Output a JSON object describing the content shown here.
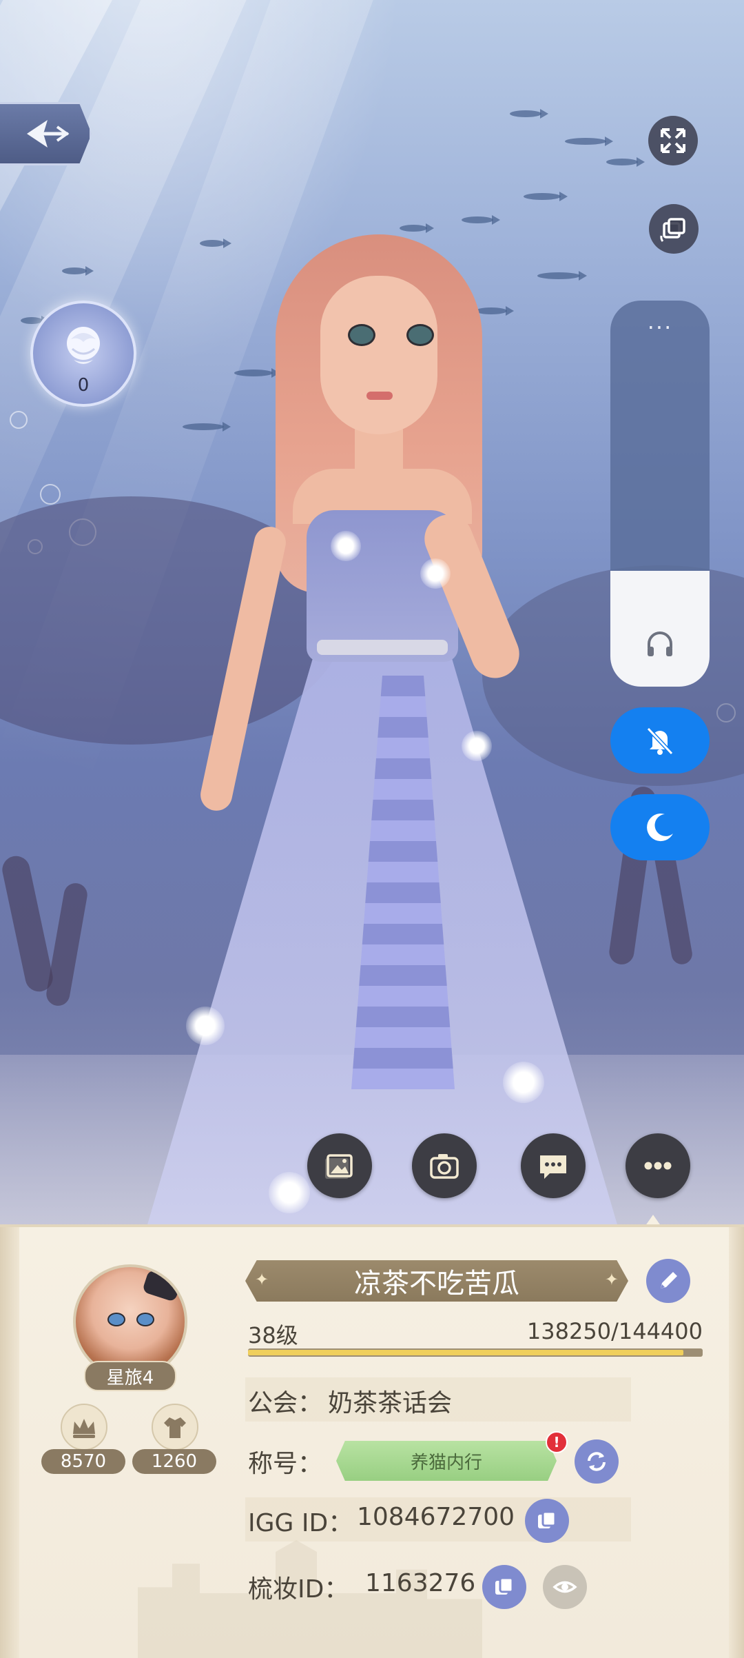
{
  "scene": {
    "rose_count": "0"
  },
  "volume": {
    "menu_dots": "···",
    "level_fraction": 0.3
  },
  "colors": {
    "accent_blue": "#1480f0",
    "card_bg": "#f6f0e3",
    "plate_brown": "#8b7a5d",
    "button_purple": "#7f8bcf",
    "title_green": "#98cf82",
    "xp_yellow": "#f0cf5c"
  },
  "icons": {
    "back": "back-arrow-icon",
    "fullscreen": "fullscreen-icon",
    "switch_view": "switch-view-icon",
    "rose": "rose-icon",
    "headphones": "headphones-icon",
    "mute": "bell-muted-icon",
    "night": "moon-icon",
    "gallery": "gallery-icon",
    "camera": "camera-icon",
    "chat": "chat-icon",
    "more": "more-icon",
    "crown": "crown-icon",
    "outfit": "outfit-icon",
    "edit": "pencil-icon",
    "refresh": "refresh-icon",
    "copy": "copy-icon",
    "visibility": "eye-icon"
  },
  "profile": {
    "rank_badge": "星旅4",
    "crown_points": "8570",
    "outfit_points": "1260",
    "nickname": "凉茶不吃苦瓜",
    "level": "38级",
    "xp": "138250/144400",
    "xp_fraction": 0.957,
    "guild_label": "公会：",
    "guild_name": "奶茶茶话会",
    "title_label": "称号：",
    "title_value": "养猫内行",
    "title_alert": "!",
    "igg_label": "IGG ID：",
    "igg_id": "1084672700",
    "makeup_label": "梳妆ID：",
    "makeup_id": "1163276"
  }
}
